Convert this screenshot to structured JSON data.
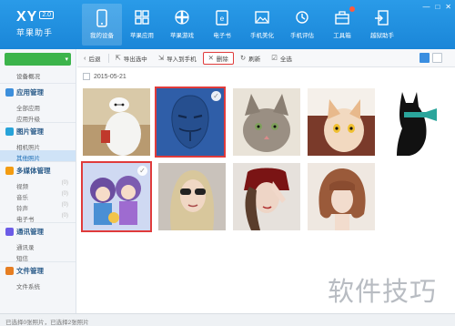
{
  "app": {
    "logo_text": "XY",
    "logo_badge": "2.0",
    "subtitle": "苹果助手"
  },
  "nav": [
    {
      "label": "我的设备",
      "icon": "phone-icon"
    },
    {
      "label": "苹果应用",
      "icon": "apps-grid-icon"
    },
    {
      "label": "苹果游戏",
      "icon": "gamepad-icon"
    },
    {
      "label": "电子书",
      "icon": "book-icon"
    },
    {
      "label": "手机美化",
      "icon": "picture-icon"
    },
    {
      "label": "手机评估",
      "icon": "evaluate-icon"
    },
    {
      "label": "工具箱",
      "icon": "toolbox-icon"
    },
    {
      "label": "越狱助手",
      "icon": "jailbreak-icon"
    }
  ],
  "window": {
    "minimize": "—",
    "maximize": "□",
    "close": "✕"
  },
  "sidebar": {
    "device_overview": "设备概况",
    "groups": [
      {
        "title": "应用管理",
        "color": "#3d8fdc",
        "items": [
          {
            "label": "全部应用"
          },
          {
            "label": "应用升级"
          }
        ]
      },
      {
        "title": "图片管理",
        "color": "#27a3d9",
        "items": [
          {
            "label": "相机照片"
          },
          {
            "label": "其他照片"
          }
        ]
      },
      {
        "title": "多媒体管理",
        "color": "#f39c12",
        "items": [
          {
            "label": "视频",
            "count": "(0)"
          },
          {
            "label": "音乐",
            "count": "(0)"
          },
          {
            "label": "铃声",
            "count": "(0)"
          },
          {
            "label": "电子书",
            "count": "(0)"
          }
        ]
      },
      {
        "title": "通讯管理",
        "color": "#6c5ce7",
        "items": [
          {
            "label": "通讯录"
          },
          {
            "label": "短信"
          }
        ]
      },
      {
        "title": "文件管理",
        "color": "#e67e22",
        "items": [
          {
            "label": "文件系统"
          }
        ]
      }
    ],
    "selected_item": "其他照片"
  },
  "toolbar": {
    "back": "后退",
    "export": "导出选中",
    "import": "导入到手机",
    "delete": "删除",
    "refresh": "刷新",
    "select_all": "全选"
  },
  "content": {
    "date": "2015-05-21",
    "photos": [
      {
        "name": "baymax",
        "selected": false
      },
      {
        "name": "anonymous-mask",
        "selected": true
      },
      {
        "name": "kitten",
        "selected": false
      },
      {
        "name": "orange-cat",
        "selected": false
      },
      {
        "name": "black-cat",
        "selected": false
      },
      {
        "name": "anime-characters",
        "selected": true
      },
      {
        "name": "girl-sunglasses",
        "selected": false
      },
      {
        "name": "girl-red-scarf",
        "selected": false
      },
      {
        "name": "girl-bob-hair",
        "selected": false
      }
    ]
  },
  "watermark": "软件技巧",
  "status": "已选择0张照片，已选择2张照片",
  "colors": {
    "header": "#1f8fe0",
    "accent": "#3a8ee0",
    "highlight": "#e03b3b",
    "device": "#3cb44b"
  }
}
